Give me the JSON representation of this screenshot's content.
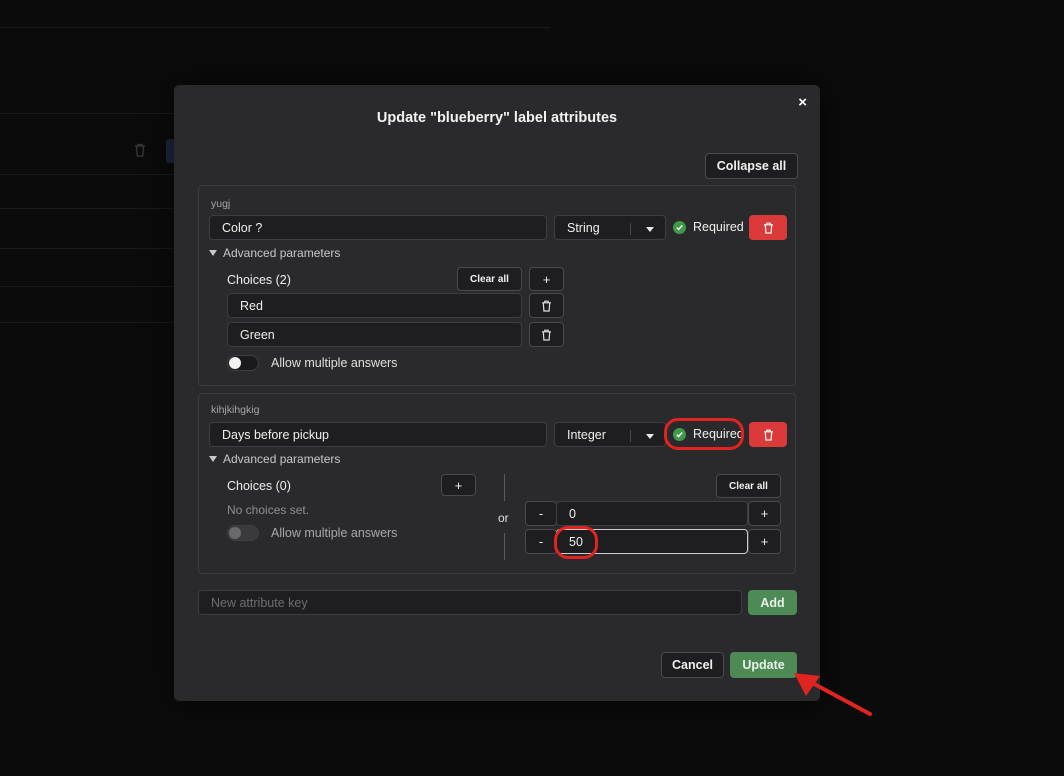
{
  "modal": {
    "title": "Update \"blueberry\" label attributes",
    "close_glyph": "×",
    "collapse_all_label": "Collapse all",
    "new_attribute_placeholder": "New attribute key",
    "add_label": "Add",
    "cancel_label": "Cancel",
    "update_label": "Update"
  },
  "attributes": [
    {
      "key": "yugj",
      "name": "Color ?",
      "type": "String",
      "required_label": "Required",
      "advanced_label": "Advanced parameters",
      "choices_title": "Choices (2)",
      "clear_all_label": "Clear all",
      "add_glyph": "+",
      "choices": [
        "Red",
        "Green"
      ],
      "allow_multiple_label": "Allow multiple answers"
    },
    {
      "key": "kihjkihgkig",
      "name": "Days before pickup",
      "type": "Integer",
      "required_label": "Required",
      "advanced_label": "Advanced parameters",
      "choices_title": "Choices (0)",
      "add_glyph": "+",
      "no_choices_text": "No choices set.",
      "allow_multiple_label": "Allow multiple answers",
      "or_label": "or",
      "range_clear_all_label": "Clear all",
      "minus_glyph": "-",
      "plus_glyph": "+",
      "range_min": "0",
      "range_max": "50"
    }
  ],
  "colors": {
    "accent_green": "#4d8a55",
    "danger_red": "#dc3a3a",
    "annotation_red": "#e0241f"
  }
}
